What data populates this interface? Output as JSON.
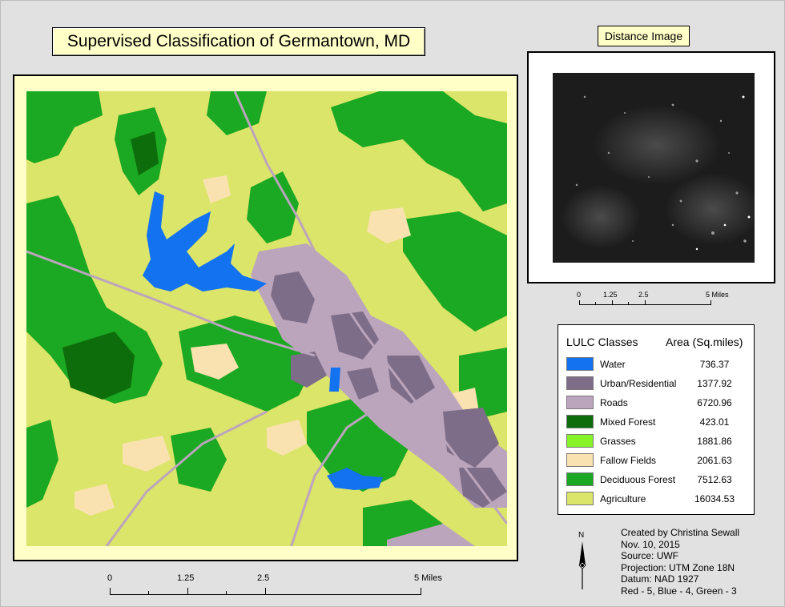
{
  "title": "Supervised Classification of Germantown, MD",
  "distance_title": "Distance Image",
  "main_scale": {
    "labels": [
      "0",
      "1.25",
      "2.5",
      "5 Miles"
    ]
  },
  "inset_scale": {
    "labels": [
      "0",
      "1.25",
      "2.5",
      "5 Miles"
    ]
  },
  "legend": {
    "header_classes": "LULC Classes",
    "header_area": "Area (Sq.miles)",
    "items": [
      {
        "name": "Water",
        "area": "736.37",
        "color": "#1372f0"
      },
      {
        "name": "Urban/Residential",
        "area": "1377.92",
        "color": "#7e6d88"
      },
      {
        "name": "Roads",
        "area": "6720.96",
        "color": "#bba5bd"
      },
      {
        "name": "Mixed Forest",
        "area": "423.01",
        "color": "#0d6d0b"
      },
      {
        "name": "Grasses",
        "area": "1881.86",
        "color": "#86f427"
      },
      {
        "name": "Fallow Fields",
        "area": "2061.63",
        "color": "#f9e2b0"
      },
      {
        "name": "Deciduous Forest",
        "area": "7512.63",
        "color": "#1ba822"
      },
      {
        "name": "Agriculture",
        "area": "16034.53",
        "color": "#dbe569"
      }
    ]
  },
  "north_arrow": {
    "label": "N",
    "icon": "north-arrow-icon"
  },
  "credits": [
    "Created by Christina Sewall",
    "Nov. 10, 2015",
    "Source: UWF",
    "Projection: UTM Zone 18N",
    "Datum: NAD 1927",
    "Red - 5, Blue - 4, Green - 3"
  ]
}
